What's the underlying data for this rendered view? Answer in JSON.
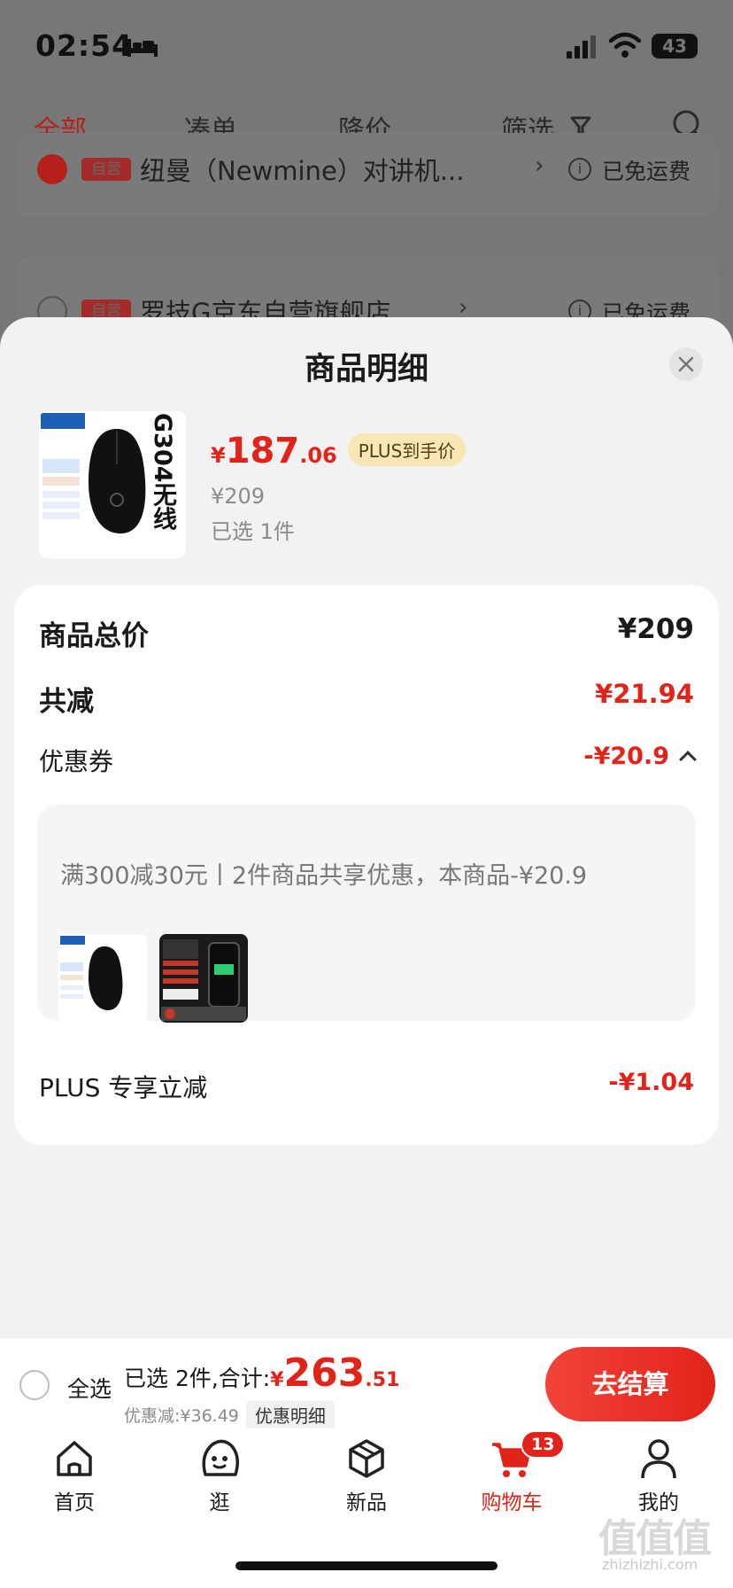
{
  "status_bar": {
    "time": "02:54",
    "battery": "43"
  },
  "filter_bar": {
    "tabs": [
      {
        "label": "全部",
        "active": true
      },
      {
        "label": "凑单",
        "active": false
      },
      {
        "label": "降价",
        "active": false
      },
      {
        "label": "筛选",
        "active": false
      }
    ]
  },
  "background_shops": [
    {
      "badge": "自营",
      "name": "纽曼（Newmine）对讲机...",
      "shipping": "已免运费",
      "checked": true
    },
    {
      "badge": "自营",
      "name": "罗技G京东自营旗舰店",
      "shipping": "已免运费",
      "checked": false
    }
  ],
  "sheet": {
    "title": "商品明细",
    "product": {
      "image_label": "G304无线",
      "price_symbol": "¥",
      "price_int": "187",
      "price_dec": ".06",
      "plus_tag": "PLUS到手价",
      "original_price": "¥209",
      "selected": "已选 1件"
    },
    "details": {
      "total_label": "商品总价",
      "total_value": "¥209",
      "reduce_label": "共减",
      "reduce_value": "¥21.94",
      "coupon_label": "优惠券",
      "coupon_value": "-¥20.9",
      "coupon_desc": "满300减30元丨2件商品共享优惠，本商品-¥20.9",
      "plus_label": "PLUS 专享立减",
      "plus_value": "-¥1.04"
    }
  },
  "checkout": {
    "select_all": "全选",
    "summary": "已选 2件,合计:",
    "total_symbol": "¥",
    "total_int": "263",
    "total_dec": ".51",
    "discount": "优惠减:¥36.49",
    "detail_link": "优惠明细",
    "button": "去结算"
  },
  "tab_bar": {
    "tabs": [
      {
        "label": "首页",
        "icon": "home-icon"
      },
      {
        "label": "逛",
        "icon": "face-icon"
      },
      {
        "label": "新品",
        "icon": "box-icon"
      },
      {
        "label": "购物车",
        "icon": "cart-icon",
        "badge": "13",
        "active": true
      },
      {
        "label": "我的",
        "icon": "person-icon"
      }
    ]
  },
  "watermark": {
    "main": "值值值",
    "sub": "zhizhizhi.com"
  },
  "colors": {
    "accent": "#e2231a",
    "plus_tag_bg": "#f7e7b4",
    "sheet_bg": "#f2f2f2"
  }
}
